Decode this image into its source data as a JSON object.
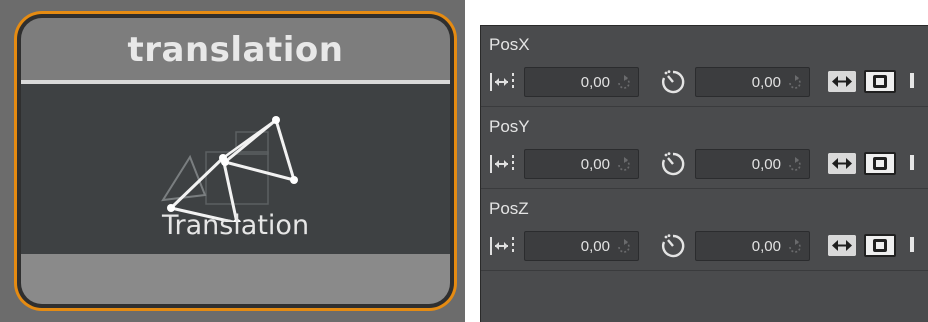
{
  "node": {
    "title": "translation",
    "caption": "Translation",
    "icon": "translation-triangles-icon",
    "colors": {
      "border": "#e58b12",
      "header": "#7d7d7d",
      "body": "#3e4143",
      "footer": "#8a8a8a"
    }
  },
  "panel": {
    "attributes": [
      {
        "label": "PosX",
        "value1": "0,00",
        "value2": "0,00"
      },
      {
        "label": "PosY",
        "value1": "0,00",
        "value2": "0,00"
      },
      {
        "label": "PosZ",
        "value1": "0,00",
        "value2": "0,00"
      }
    ],
    "icons": [
      "arrow-range-icon",
      "reset-icon",
      "timer-icon",
      "swap-icon",
      "camera-icon",
      "bar-icon"
    ],
    "colors": {
      "background": "#4a4b4d",
      "field": "#3c3d3f",
      "text": "#e4e4e4"
    }
  }
}
